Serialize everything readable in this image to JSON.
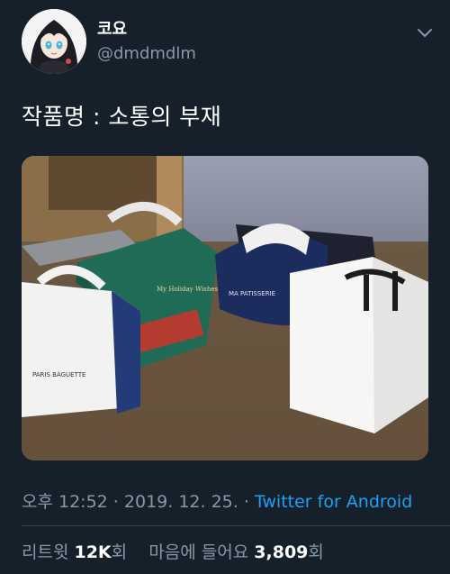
{
  "user": {
    "display_name": "코요",
    "handle": "@dmdmdlm"
  },
  "tweet": {
    "text": "작품명 : 소통의 부재"
  },
  "photo": {
    "box_labels": [
      "PARIS BAGUETTE",
      "My Holiday Wishes",
      "MA PATISSERIE"
    ]
  },
  "meta": {
    "time": "오후 12:52",
    "sep1": " · ",
    "date": "2019. 12. 25.",
    "sep2": " · ",
    "source": "Twitter for Android"
  },
  "stats": {
    "retweets_label": "리트윗 ",
    "retweets_count": "12K",
    "retweets_unit": "회",
    "likes_label": "마음에 들어요 ",
    "likes_count": "3,809",
    "likes_unit": "회"
  },
  "icons": [
    "avatar",
    "chevron-down-icon"
  ],
  "colors": {
    "background": "#15202b",
    "secondary_text": "#8899a6",
    "link": "#1da1f2"
  }
}
